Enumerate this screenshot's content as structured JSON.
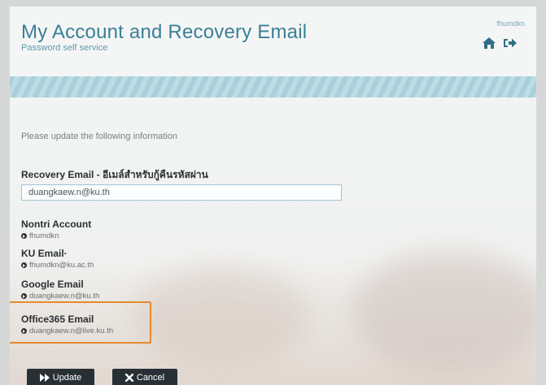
{
  "header": {
    "title": "My Account and Recovery Email",
    "subtitle": "Password self service",
    "username": "fhumdkn",
    "home_icon": "home-icon",
    "signout_icon": "sign-out-icon"
  },
  "form": {
    "intro": "Please update the following information",
    "recovery_label": "Recovery Email - อีเมล์สำหรับกู้คืนรหัสผ่าน",
    "recovery_value": "duangkaew.n@ku.th",
    "fields": [
      {
        "label": "Nontri Account",
        "value": "fhumdkn"
      },
      {
        "label": "KU Email·",
        "value": "fhumdkn@ku.ac.th"
      },
      {
        "label": "Google Email",
        "value": "duangkaew.n@ku.th"
      },
      {
        "label": "Office365 Email",
        "value": "duangkaew.n@live.ku.th"
      }
    ],
    "highlight_color": "#e68a2c"
  },
  "buttons": {
    "update_label": "Update",
    "cancel_label": "Cancel"
  },
  "colors": {
    "title": "#3a7f96",
    "button_bg": "#283035",
    "banner": "#a9cfda"
  }
}
